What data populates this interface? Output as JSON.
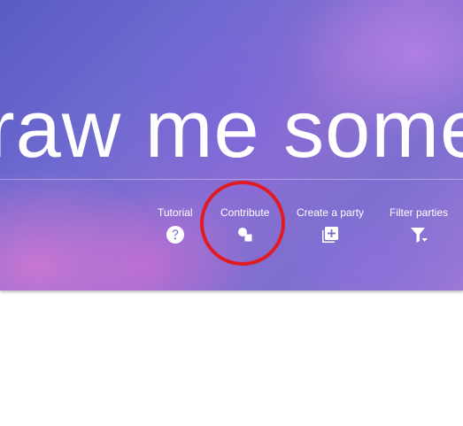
{
  "hero": {
    "title": "raw me some"
  },
  "nav": {
    "tutorial_label": "Tutorial",
    "contribute_label": "Contribute",
    "create_party_label": "Create a party",
    "filter_parties_label": "Filter parties"
  },
  "colors": {
    "highlight_ring": "#e11b23",
    "nav_text": "#ffffff"
  }
}
